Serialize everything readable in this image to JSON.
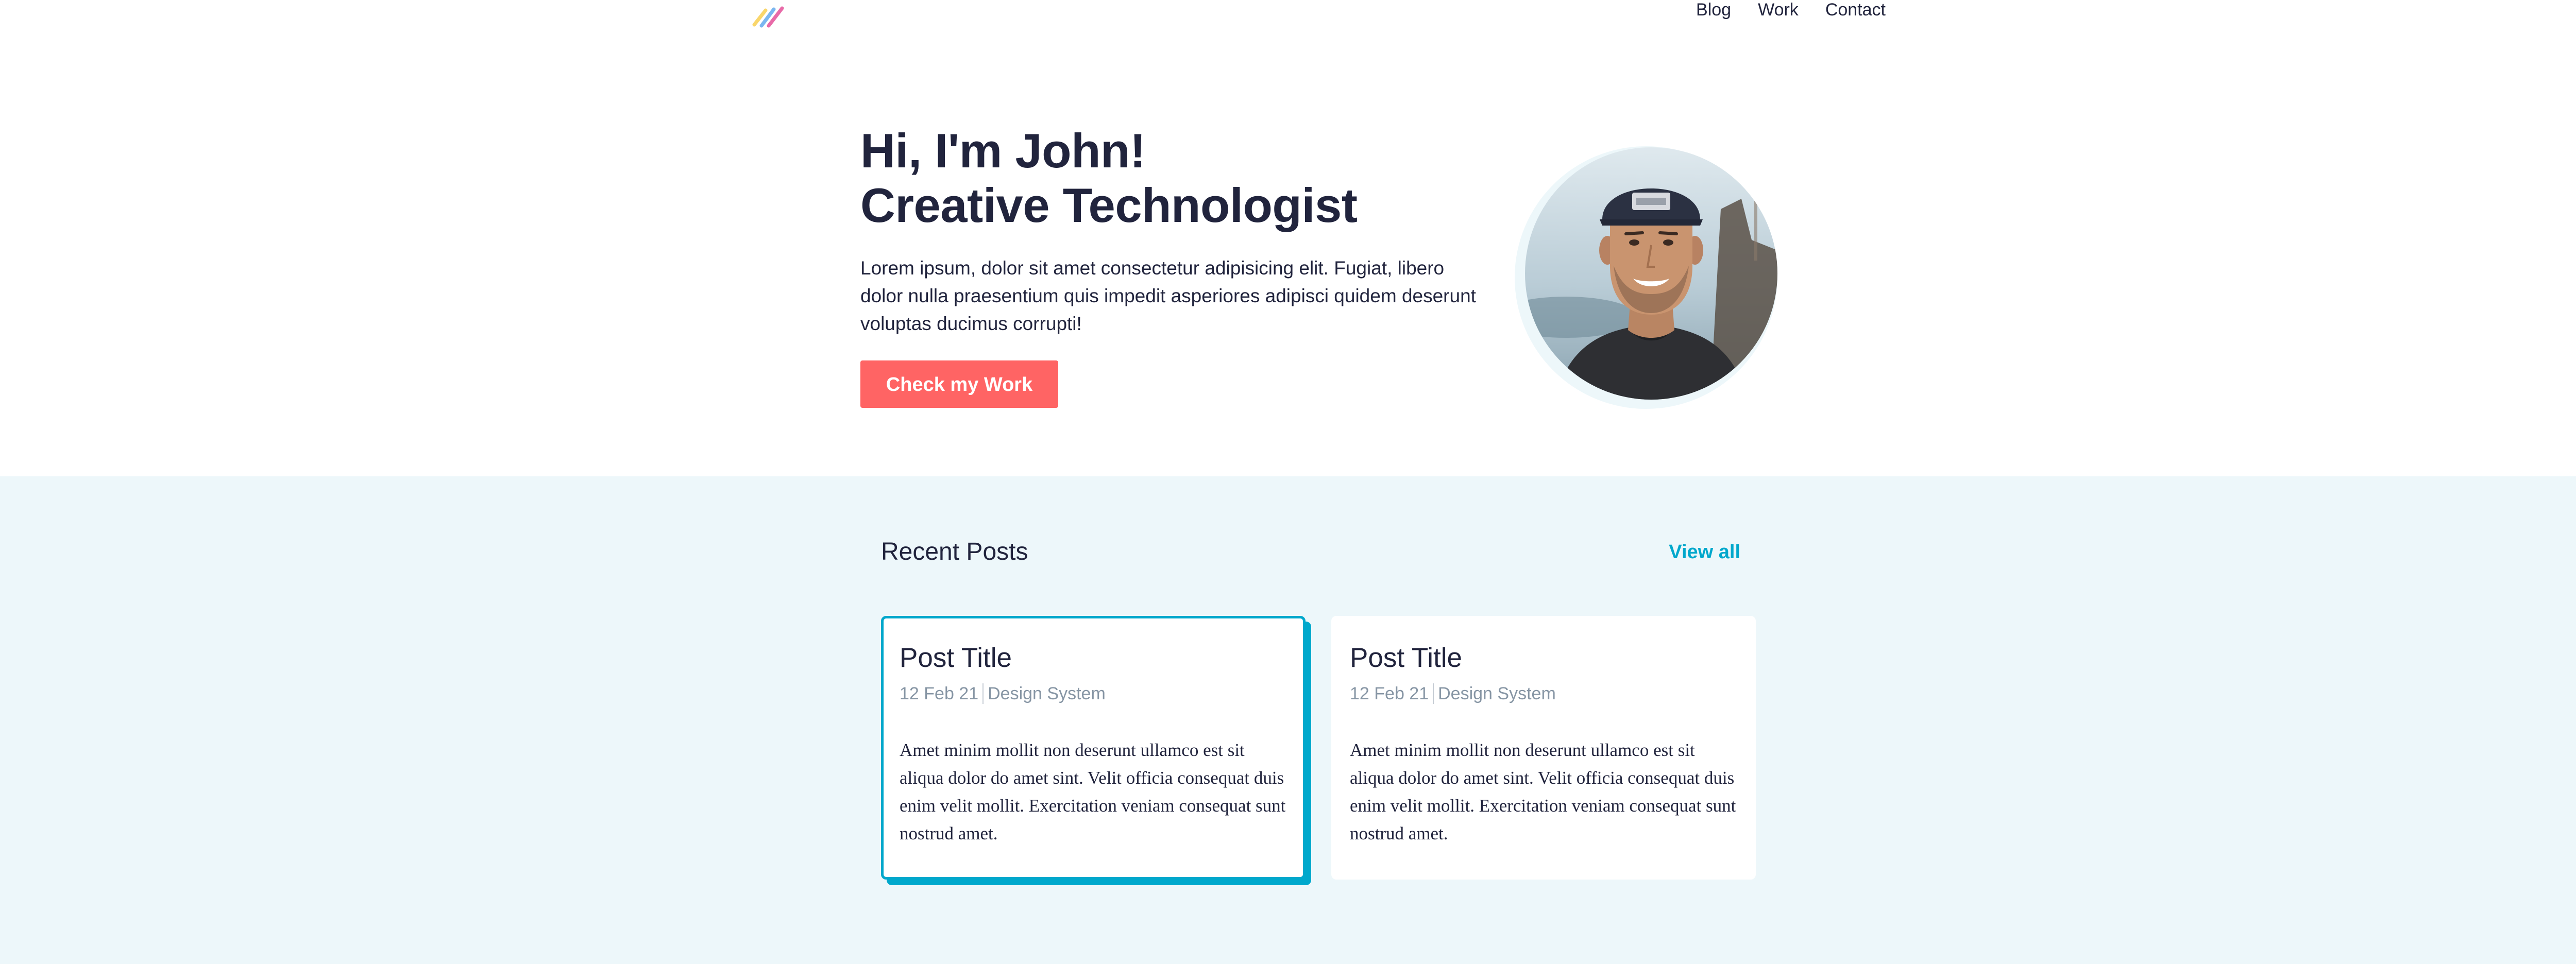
{
  "header": {
    "logo_icon": "multicolor-stripes-logo",
    "nav": [
      {
        "label": "Blog"
      },
      {
        "label": "Work"
      },
      {
        "label": "Contact"
      }
    ]
  },
  "hero": {
    "title_line1": "Hi, I'm John!",
    "title_line2": "Creative Technologist",
    "description": "Lorem ipsum, dolor sit amet consectetur adipisicing elit. Fugiat, libero dolor nulla praesentium quis impedit asperiores adipisci quidem deserunt voluptas ducimus corrupti!",
    "cta_label": "Check my Work",
    "cta_color": "#ff6464"
  },
  "recent_posts": {
    "title": "Recent Posts",
    "view_all_label": "View all",
    "accent_color": "#00a8cc",
    "posts": [
      {
        "title": "Post Title",
        "date": "12 Feb 21",
        "category": "Design System",
        "excerpt": "Amet minim mollit non deserunt ullamco est sit aliqua dolor do amet sint. Velit officia consequat duis enim velit mollit. Exercitation veniam consequat sunt nostrud amet."
      },
      {
        "title": "Post Title",
        "date": "12 Feb 21",
        "category": "Design System",
        "excerpt": "Amet minim mollit non deserunt ullamco est sit aliqua dolor do amet sint. Velit officia consequat duis enim velit mollit. Exercitation veniam consequat sunt nostrud amet."
      }
    ]
  }
}
